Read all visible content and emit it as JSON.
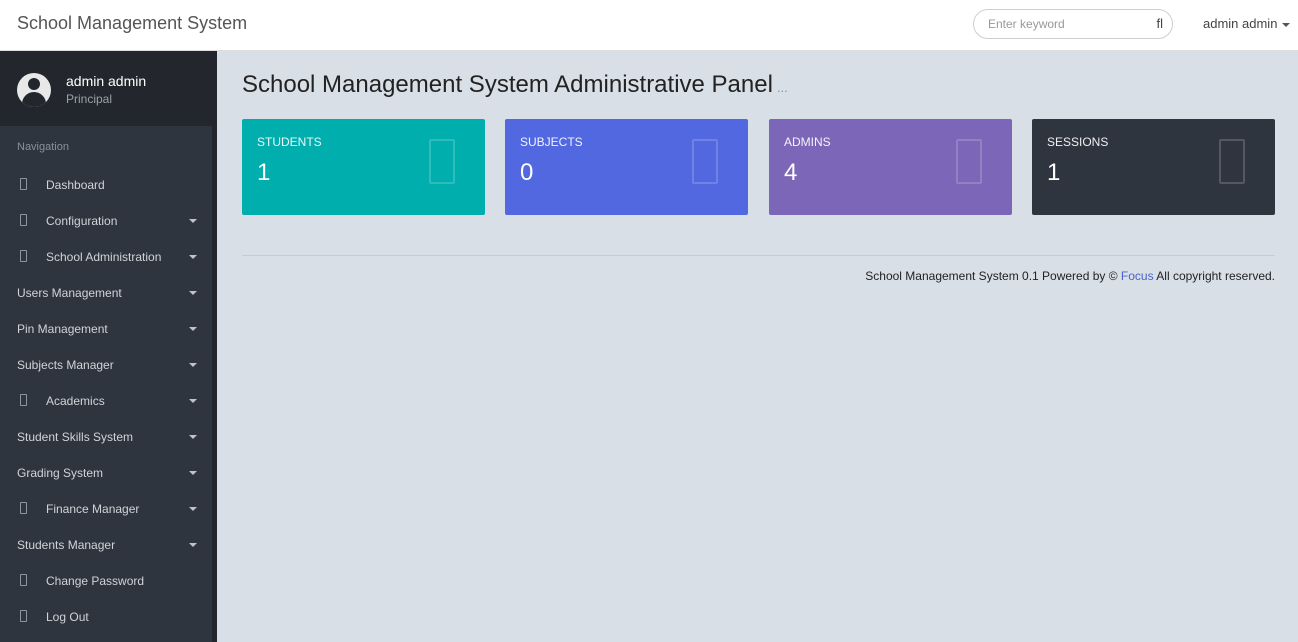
{
  "app": {
    "brand": "School Management System"
  },
  "header": {
    "search_placeholder": "Enter keyword",
    "search_icon": "search-icon",
    "search_glyph": "fl",
    "user_label": "admin admin"
  },
  "profile": {
    "name": "admin admin",
    "role": "Principal"
  },
  "sidebar": {
    "nav_header": "Navigation",
    "items": [
      {
        "label": "Dashboard",
        "icon": true,
        "caret": false
      },
      {
        "label": "Configuration",
        "icon": true,
        "caret": true
      },
      {
        "label": "School Administration",
        "icon": true,
        "caret": true
      },
      {
        "label": "Users Management",
        "icon": false,
        "caret": true
      },
      {
        "label": "Pin Management",
        "icon": false,
        "caret": true
      },
      {
        "label": "Subjects Manager",
        "icon": false,
        "caret": true
      },
      {
        "label": "Academics",
        "icon": true,
        "caret": true
      },
      {
        "label": "Student Skills System",
        "icon": false,
        "caret": true
      },
      {
        "label": "Grading System",
        "icon": false,
        "caret": true
      },
      {
        "label": "Finance Manager",
        "icon": true,
        "caret": true
      },
      {
        "label": "Students Manager",
        "icon": false,
        "caret": true
      },
      {
        "label": "Change Password",
        "icon": true,
        "caret": false
      },
      {
        "label": "Log Out",
        "icon": true,
        "caret": false
      }
    ]
  },
  "main": {
    "title": "School Management System Administrative Panel",
    "title_suffix": "...",
    "cards": {
      "students": {
        "label": "STUDENTS",
        "value": "1",
        "color": "#00aeae"
      },
      "subjects": {
        "label": "SUBJECTS",
        "value": "0",
        "color": "#5168e0"
      },
      "admins": {
        "label": "ADMINS",
        "value": "4",
        "color": "#7c66b7"
      },
      "sessions": {
        "label": "SESSIONS",
        "value": "1",
        "color": "#2f353e"
      }
    }
  },
  "footer": {
    "prefix": "School Management System 0.1 Powered by © ",
    "link": "Focus",
    "suffix": " All copyright reserved."
  }
}
